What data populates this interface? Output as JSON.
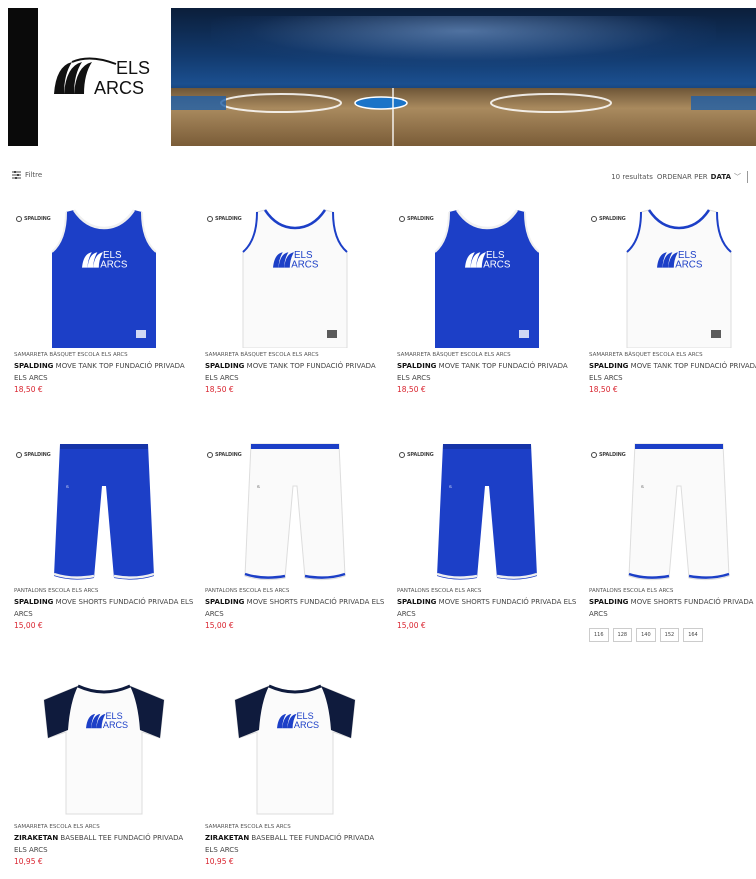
{
  "brand": {
    "logo_text_top": "ELS",
    "logo_text_bottom": "ARCS"
  },
  "toolbar": {
    "filter_label": "Filtre",
    "results_text": "10 resultats",
    "sort_prefix": "ORDENAR PER",
    "sort_value": "DATA"
  },
  "products": [
    {
      "category": "SAMARRETA BÀSQUET ESCOLA ELS ARCS",
      "brand": "SPALDING",
      "name": " MOVE TANK TOP FUNDACIÓ PRIVADA ELS ARCS",
      "price": "18,50 €",
      "type": "tank",
      "color": "blue"
    },
    {
      "category": "SAMARRETA BÀSQUET ESCOLA ELS ARCS",
      "brand": "SPALDING",
      "name": " MOVE TANK TOP FUNDACIÓ PRIVADA ELS ARCS",
      "price": "18,50 €",
      "type": "tank",
      "color": "white"
    },
    {
      "category": "SAMARRETA BÀSQUET ESCOLA ELS ARCS",
      "brand": "SPALDING",
      "name": " MOVE TANK TOP FUNDACIÓ PRIVADA ELS ARCS",
      "price": "18,50 €",
      "type": "tank",
      "color": "blue"
    },
    {
      "category": "SAMARRETA BÀSQUET ESCOLA ELS ARCS",
      "brand": "SPALDING",
      "name": " MOVE TANK TOP FUNDACIÓ PRIVADA ELS ARCS",
      "price": "18,50 €",
      "type": "tank",
      "color": "white"
    },
    {
      "category": "PANTALONS ESCOLA ELS ARCS",
      "brand": "SPALDING",
      "name": " MOVE SHORTS FUNDACIÓ PRIVADA ELS ARCS",
      "price": "15,00 €",
      "type": "shorts",
      "color": "blue"
    },
    {
      "category": "PANTALONS ESCOLA ELS ARCS",
      "brand": "SPALDING",
      "name": " MOVE SHORTS FUNDACIÓ PRIVADA ELS ARCS",
      "price": "15,00 €",
      "type": "shorts",
      "color": "white"
    },
    {
      "category": "PANTALONS ESCOLA ELS ARCS",
      "brand": "SPALDING",
      "name": " MOVE SHORTS FUNDACIÓ PRIVADA ELS ARCS",
      "price": "15,00 €",
      "type": "shorts",
      "color": "blue"
    },
    {
      "category": "PANTALONS ESCOLA ELS ARCS",
      "brand": "SPALDING",
      "name": " MOVE SHORTS FUNDACIÓ PRIVADA ELS ARCS",
      "price": "",
      "type": "shorts",
      "color": "white",
      "sizes": [
        "116",
        "128",
        "140",
        "152",
        "164"
      ]
    },
    {
      "category": "SAMARRETA ESCOLA ELS ARCS",
      "brand": "ZIRAKETAN",
      "name": " BASEBALL TEE FUNDACIÓ PRIVADA ELS ARCS",
      "price": "10,95 €",
      "type": "tee",
      "color": "white"
    },
    {
      "category": "SAMARRETA ESCOLA ELS ARCS",
      "brand": "ZIRAKETAN",
      "name": " BASEBALL TEE FUNDACIÓ PRIVADA ELS ARCS",
      "price": "10,95 €",
      "type": "tee",
      "color": "white"
    }
  ],
  "spalding_logo_text": "SPALDING",
  "colors": {
    "royal_blue": "#1c3fc7",
    "price_red": "#d9242f",
    "navy": "#0f1b3d"
  }
}
